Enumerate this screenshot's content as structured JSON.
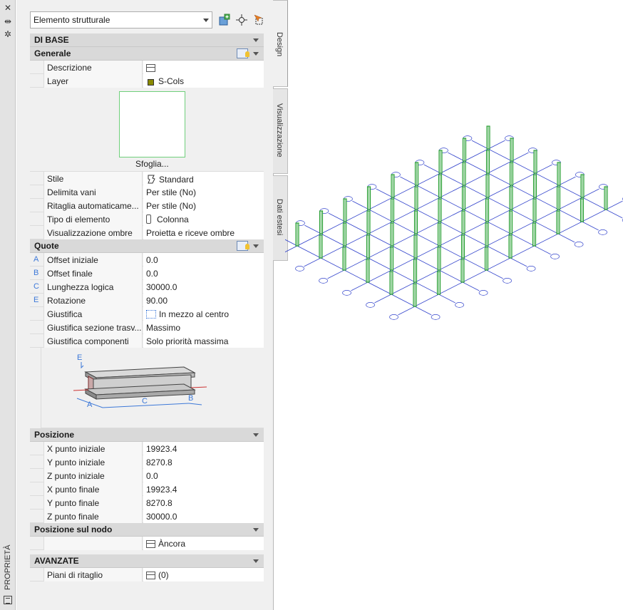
{
  "strip": {
    "title": "PROPRIETÀ",
    "close_glyph": "✕",
    "pin_glyph": "⇹",
    "settings_glyph": "✲"
  },
  "selector": {
    "value": "Elemento strutturale"
  },
  "tabs": {
    "design": "Design",
    "visualizzazione": "Visualizzazione",
    "dati_estesi": "Dati estesi"
  },
  "sections": {
    "di_base": "DI BASE",
    "generale": "Generale",
    "quote": "Quote",
    "posizione": "Posizione",
    "posizione_nodo": "Posizione sul nodo",
    "avanzate": "AVANZATE"
  },
  "generale": [
    {
      "name": "Descrizione",
      "value": "",
      "icon": "table-icon"
    },
    {
      "name": "Layer",
      "value": "S-Cols",
      "icon": "layer-color-icon"
    }
  ],
  "preview": {
    "browse_label": "Sfoglia..."
  },
  "generale2": [
    {
      "name": "Stile",
      "value": "Standard",
      "icon": "style-icon"
    },
    {
      "name": "Delimita vani",
      "value": "Per stile (No)"
    },
    {
      "name": "Ritaglia  automaticame...",
      "value": "Per stile (No)"
    },
    {
      "name": "Tipo di elemento",
      "value": "Colonna",
      "icon": "column-icon"
    },
    {
      "name": "Visualizzazione ombre",
      "value": "Proietta e riceve ombre"
    }
  ],
  "quote": [
    {
      "letter": "A",
      "name": "Offset iniziale",
      "value": "0.0"
    },
    {
      "letter": "B",
      "name": "Offset finale",
      "value": "0.0"
    },
    {
      "letter": "C",
      "name": "Lunghezza logica",
      "value": "30000.0"
    },
    {
      "letter": "E",
      "name": "Rotazione",
      "value": "90.00"
    },
    {
      "letter": "",
      "name": "Giustifica",
      "value": "In mezzo al centro",
      "icon": "justify-icon"
    },
    {
      "letter": "",
      "name": "Giustifica  sezione  trasv...",
      "value": "Massimo"
    },
    {
      "letter": "",
      "name": "Giustifica componenti",
      "value": "Solo priorità massima"
    }
  ],
  "diagram_labels": {
    "a": "A",
    "b": "B",
    "c": "C",
    "e": "E"
  },
  "posizione": [
    {
      "name": "X punto iniziale",
      "value": "19923.4"
    },
    {
      "name": "Y punto iniziale",
      "value": "8270.8"
    },
    {
      "name": "Z punto iniziale",
      "value": "0.0"
    },
    {
      "name": "X punto finale",
      "value": "19923.4"
    },
    {
      "name": "Y punto finale",
      "value": "8270.8"
    },
    {
      "name": "Z punto finale",
      "value": "30000.0"
    }
  ],
  "posizione_nodo": {
    "value": "Àncora"
  },
  "avanzate": [
    {
      "name": "Piani di ritaglio",
      "value": "(0)"
    }
  ],
  "colors": {
    "grid_line": "#3344cc",
    "column": "#1f9a2a",
    "accent": "#3c78d8"
  }
}
